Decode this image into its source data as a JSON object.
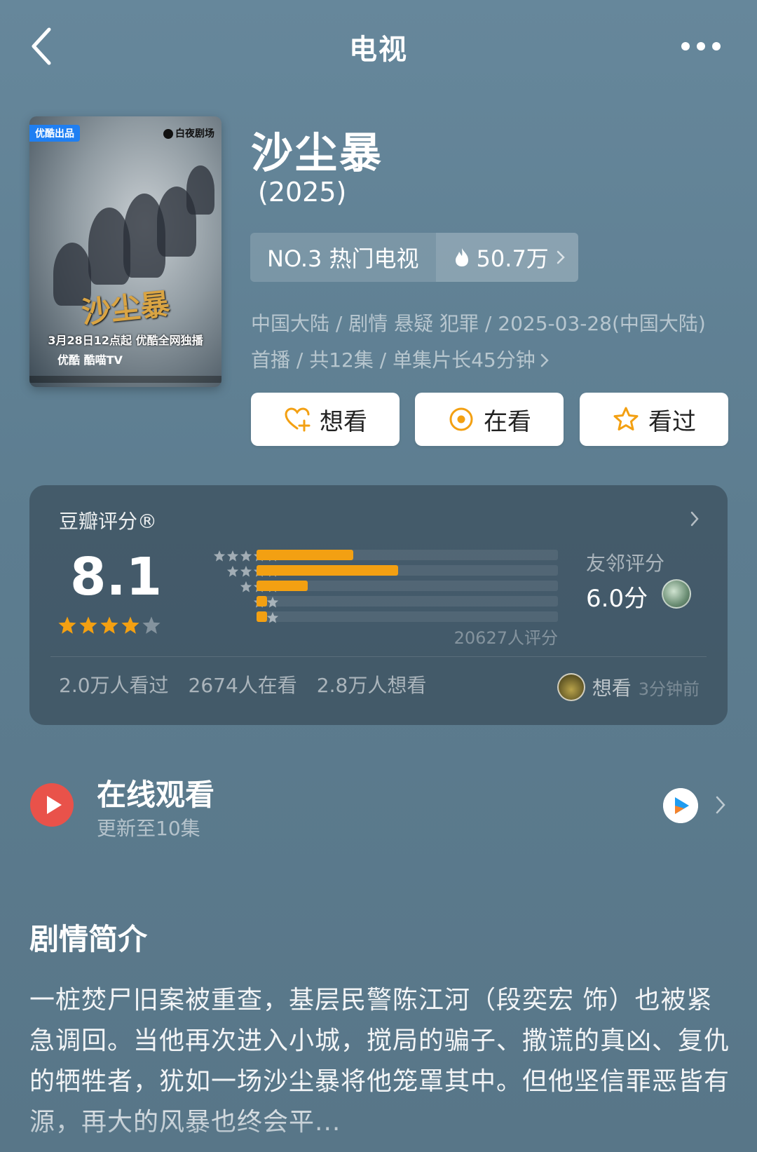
{
  "header": {
    "title": "电视"
  },
  "poster": {
    "badge": "优酷出品",
    "brand": "白夜剧场",
    "calligraphy": "沙尘暴",
    "date_line": "3月28日12点起 优酷全网独播",
    "platforms": "优酷  酷喵TV"
  },
  "show": {
    "title": "沙尘暴",
    "year": "(2025)",
    "rank_label": "NO.3 热门电视",
    "heat": "50.7万",
    "meta": "中国大陆 / 剧情 悬疑 犯罪 / 2025-03-28(中国大陆) 首播 / 共12集 / 单集片长45分钟"
  },
  "actions": {
    "want": "想看",
    "watching": "在看",
    "watched": "看过"
  },
  "rating": {
    "label": "豆瓣评分®",
    "score": "8.1",
    "stars": 4,
    "distribution": [
      0.32,
      0.47,
      0.17,
      0.035,
      0.035
    ],
    "count": "20627人评分",
    "neighbor_label": "友邻评分",
    "neighbor_score": "6.0分",
    "stats": [
      "2.0万人看过",
      "2674人在看",
      "2.8万人想看"
    ],
    "recent_action": "想看",
    "recent_time": "3分钟前",
    "colors": {
      "bar": "#f3a012",
      "star": "#f3a012"
    }
  },
  "watch": {
    "title": "在线观看",
    "subtitle": "更新至10集"
  },
  "synopsis": {
    "title": "剧情简介",
    "text": "一桩焚尸旧案被重查，基层民警陈江河（段奕宏 饰）也被紧急调回。当他再次进入小城，搅局的骗子、撒谎的真凶、复仇的牺牲者，犹如一场沙尘暴将他笼罩其中。但他坚信罪恶皆有源，再大的风暴也终会平..."
  }
}
